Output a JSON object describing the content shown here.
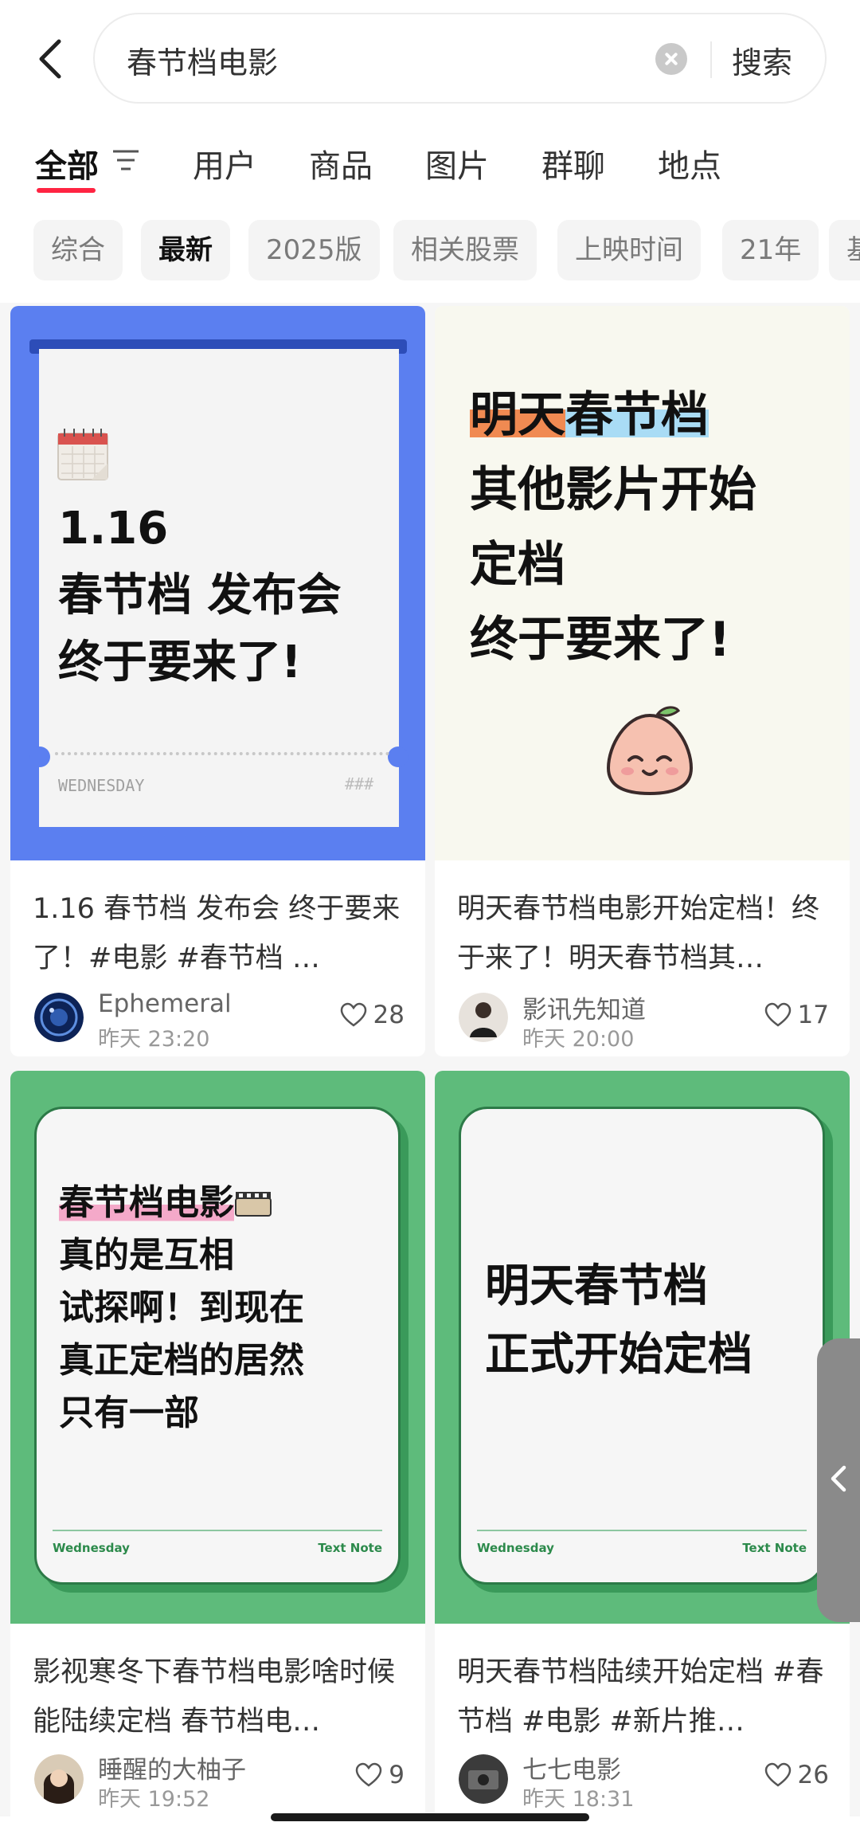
{
  "search": {
    "query": "春节档电影",
    "button_label": "搜索"
  },
  "tabs": [
    {
      "label": "全部",
      "active": true
    },
    {
      "label": "用户"
    },
    {
      "label": "商品"
    },
    {
      "label": "图片"
    },
    {
      "label": "群聊"
    },
    {
      "label": "地点"
    }
  ],
  "chips": [
    {
      "label": "综合"
    },
    {
      "label": "最新",
      "active": true
    },
    {
      "label": "2025版"
    },
    {
      "label": "相关股票"
    },
    {
      "label": "上映时间"
    },
    {
      "label": "21年"
    },
    {
      "label": "基"
    }
  ],
  "colors": {
    "accent": "#ff2442",
    "card1_cover": "#5b7ff0",
    "card2_cover": "#f8f8ef",
    "green_cover": "#5ebb7b"
  },
  "cards": [
    {
      "cover_lines": [
        "1.16",
        "春节档 发布会",
        "终于要来了!"
      ],
      "cover_footer_left": "WEDNESDAY",
      "cover_footer_right": "###",
      "title": "1.16 春节档 发布会 终于要来了！#电影 #春节档 …",
      "author": "Ephemeral",
      "time": "昨天 23:20",
      "likes": "28"
    },
    {
      "cover_hl1": "明天",
      "cover_hl2": "春节档",
      "cover_lines": [
        "其他影片开始",
        "定档",
        "终于要来了!"
      ],
      "title": "明天春节档电影开始定档！终于来了！明天春节档其…",
      "author": "影讯先知道",
      "time": "昨天 20:00",
      "likes": "17"
    },
    {
      "cover_hl": "春节档电影",
      "cover_lines": [
        "真的是互相",
        "试探啊！到现在",
        "真正定档的居然",
        "只有一部"
      ],
      "cover_footer_left": "Wednesday",
      "cover_footer_right": "Text Note",
      "title": "影视寒冬下春节档电影啥时候能陆续定档 春节档电…",
      "author": "睡醒的大柚子",
      "time": "昨天 19:52",
      "likes": "9"
    },
    {
      "cover_lines": [
        "明天春节档",
        "正式开始定档"
      ],
      "cover_footer_left": "Wednesday",
      "cover_footer_right": "Text Note",
      "title": "明天春节档陆续开始定档 #春节档 #电影 #新片推…",
      "author": "七七电影",
      "time": "昨天 18:31",
      "likes": "26"
    }
  ]
}
